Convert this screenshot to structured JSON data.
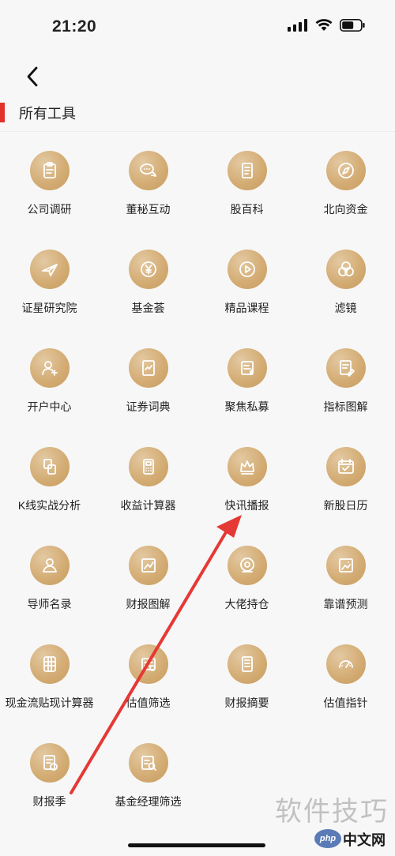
{
  "status_bar": {
    "time": "21:20"
  },
  "header": {
    "title": "所有工具"
  },
  "tools": [
    {
      "label": "公司调研",
      "icon": "clipboard-icon"
    },
    {
      "label": "董秘互动",
      "icon": "chat-bubbles-icon"
    },
    {
      "label": "股百科",
      "icon": "document-icon"
    },
    {
      "label": "北向资金",
      "icon": "compass-icon"
    },
    {
      "label": "证星研究院",
      "icon": "plane-icon"
    },
    {
      "label": "基金荟",
      "icon": "yuan-coin-icon"
    },
    {
      "label": "精品课程",
      "icon": "play-icon"
    },
    {
      "label": "滤镜",
      "icon": "filter-circles-icon"
    },
    {
      "label": "开户中心",
      "icon": "add-user-icon"
    },
    {
      "label": "证券词典",
      "icon": "dictionary-icon"
    },
    {
      "label": "聚焦私募",
      "icon": "private-fund-icon"
    },
    {
      "label": "指标图解",
      "icon": "edit-document-icon"
    },
    {
      "label": "K线实战分析",
      "icon": "kline-icon"
    },
    {
      "label": "收益计算器",
      "icon": "calculator-icon"
    },
    {
      "label": "快讯播报",
      "icon": "crown-icon"
    },
    {
      "label": "新股日历",
      "icon": "calendar-icon"
    },
    {
      "label": "导师名录",
      "icon": "mentor-icon"
    },
    {
      "label": "财报图解",
      "icon": "chart-report-icon"
    },
    {
      "label": "大佬持仓",
      "icon": "portfolio-icon"
    },
    {
      "label": "靠谱预测",
      "icon": "image-chart-icon"
    },
    {
      "label": "现金流贴现计算器",
      "icon": "grid-calculator-icon"
    },
    {
      "label": "估值筛选",
      "icon": "valuation-screen-icon"
    },
    {
      "label": "财报摘要",
      "icon": "report-summary-icon"
    },
    {
      "label": "估值指针",
      "icon": "gauge-icon"
    },
    {
      "label": "财报季",
      "icon": "season-report-icon"
    },
    {
      "label": "基金经理筛选",
      "icon": "manager-search-icon"
    }
  ],
  "watermark": {
    "logo_text": "软件技巧",
    "php_badge": "php",
    "site": "中文网"
  },
  "colors": {
    "accent": "#e0312a",
    "icon_gold": "#d4ad75",
    "arrow_red": "#e53935"
  }
}
